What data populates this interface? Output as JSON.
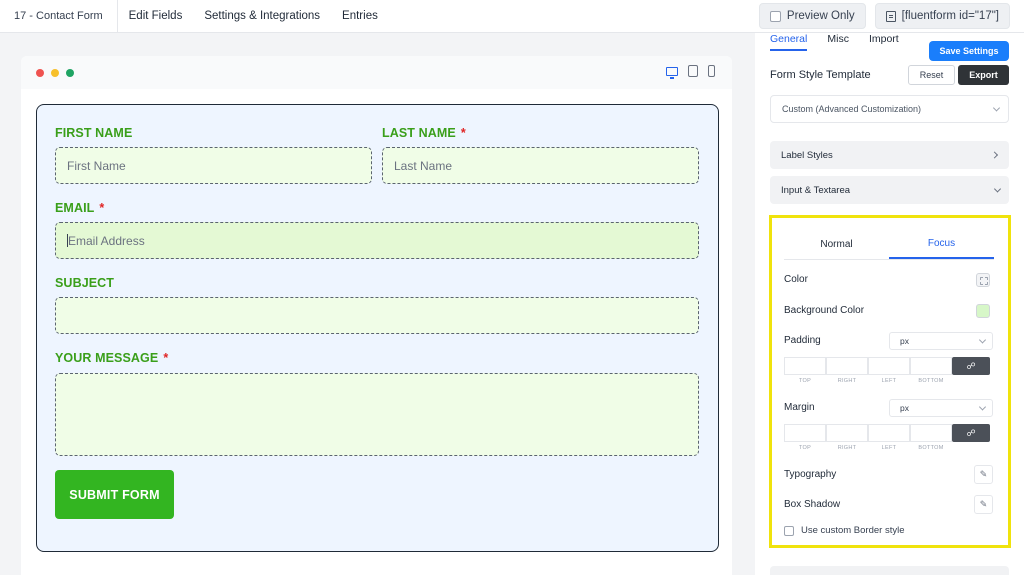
{
  "topbar": {
    "breadcrumb": "17 - Contact Form",
    "nav": [
      "Edit Fields",
      "Settings & Integrations",
      "Entries"
    ],
    "preview_label": "Preview Only",
    "shortcode": "[fluentform id=\"17\"]"
  },
  "form": {
    "first_name": {
      "label": "FIRST NAME",
      "placeholder": "First Name"
    },
    "last_name": {
      "label": "LAST NAME",
      "placeholder": "Last Name",
      "required": "*"
    },
    "email": {
      "label": "EMAIL",
      "placeholder": "Email Address",
      "required": "*"
    },
    "subject": {
      "label": "SUBJECT"
    },
    "message": {
      "label": "YOUR MESSAGE",
      "required": "*"
    },
    "submit_label": "SUBMIT FORM"
  },
  "panel": {
    "tabs": [
      "General",
      "Misc",
      "Import"
    ],
    "save_label": "Save Settings",
    "template_label": "Form Style Template",
    "reset_label": "Reset",
    "export_label": "Export",
    "template_value": "Custom (Advanced Customization)",
    "label_styles": "Label Styles",
    "input_textarea": "Input & Textarea",
    "state_tabs": [
      "Normal",
      "Focus"
    ],
    "color_label": "Color",
    "bg_color_label": "Background Color",
    "padding_label": "Padding",
    "margin_label": "Margin",
    "unit_value": "px",
    "box_labels": [
      "TOP",
      "RIGHT",
      "LEFT",
      "BOTTOM"
    ],
    "typography_label": "Typography",
    "box_shadow_label": "Box Shadow",
    "border_label": "Use custom Border style"
  },
  "colors": {
    "label_green": "#3a9f1a",
    "submit_green": "#33b521",
    "field_bg": "#f0fde7",
    "form_bg": "#eef5ff",
    "accent_blue": "#2563eb",
    "highlight_yellow": "#f0e30c"
  }
}
